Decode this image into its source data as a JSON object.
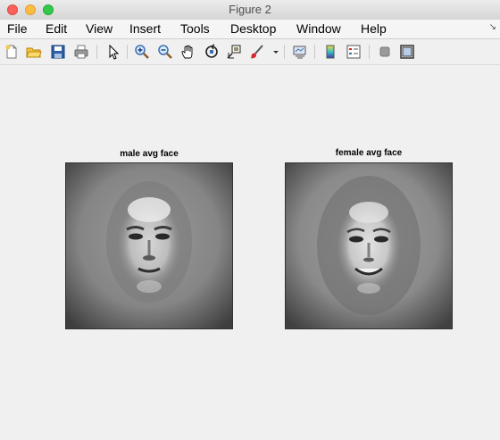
{
  "window": {
    "title": "Figure 2"
  },
  "menu": {
    "items": [
      "File",
      "Edit",
      "View",
      "Insert",
      "Tools",
      "Desktop",
      "Window",
      "Help"
    ]
  },
  "toolbar": {
    "icons": [
      "new-figure-icon",
      "open-file-icon",
      "save-icon",
      "print-icon",
      "select-arrow-icon",
      "zoom-in-icon",
      "zoom-out-icon",
      "pan-hand-icon",
      "rotate-3d-icon",
      "data-cursor-icon",
      "brush-icon",
      "brush-dropdown-icon",
      "link-plot-icon",
      "colorbar-icon",
      "legend-icon",
      "hide-plot-tools-icon",
      "show-plot-tools-icon"
    ]
  },
  "figure": {
    "axes": [
      {
        "title": "male avg face"
      },
      {
        "title": "female avg face"
      }
    ]
  }
}
